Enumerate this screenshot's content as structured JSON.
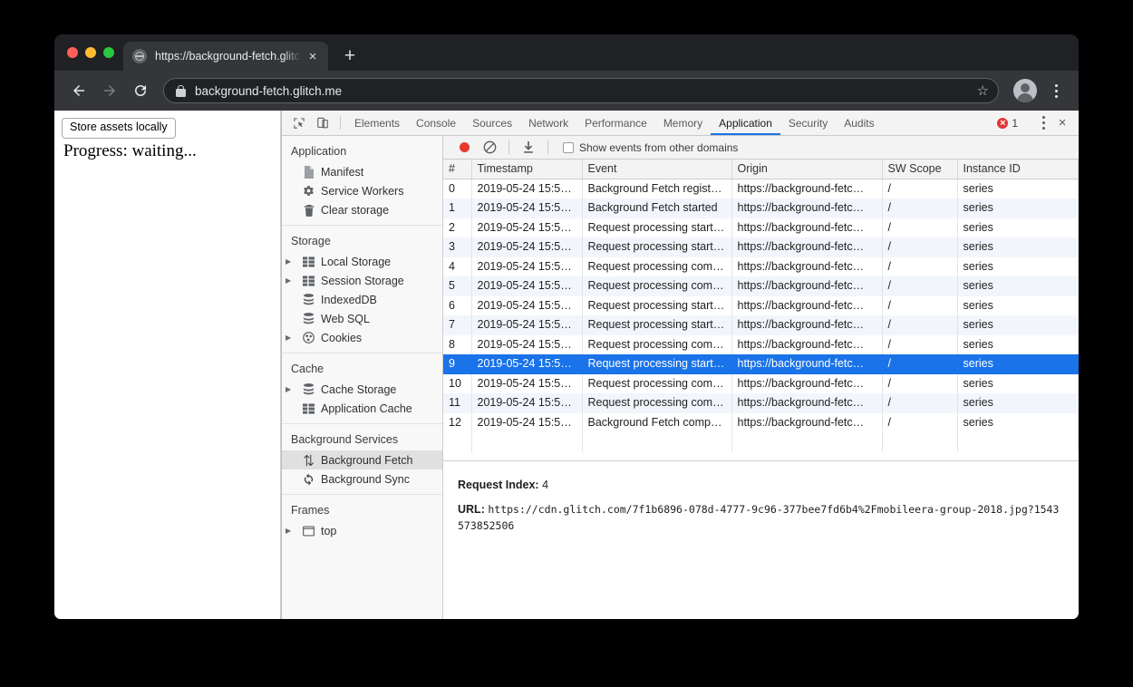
{
  "browser": {
    "tab": {
      "title": "https://background-fetch.glitch",
      "favicon": "globe-icon",
      "close": "×"
    },
    "new_tab": "+",
    "nav": {
      "back": "←",
      "forward": "→",
      "reload": "↻"
    },
    "omnibox": {
      "url": "background-fetch.glitch.me",
      "lock": "lock-icon",
      "star": "☆"
    },
    "menu": "kebab-menu-icon"
  },
  "page": {
    "store_button": "Store assets locally",
    "progress": "Progress: waiting..."
  },
  "devtools": {
    "tabs": [
      {
        "label": "Elements",
        "active": false
      },
      {
        "label": "Console",
        "active": false
      },
      {
        "label": "Sources",
        "active": false
      },
      {
        "label": "Network",
        "active": false
      },
      {
        "label": "Performance",
        "active": false
      },
      {
        "label": "Memory",
        "active": false
      },
      {
        "label": "Application",
        "active": true
      },
      {
        "label": "Security",
        "active": false
      },
      {
        "label": "Audits",
        "active": false
      }
    ],
    "error_count": "1",
    "close": "×",
    "sidebar": {
      "groups": [
        {
          "header": "Application",
          "items": [
            {
              "label": "Manifest",
              "icon": "document-icon",
              "arrow": false,
              "selected": false
            },
            {
              "label": "Service Workers",
              "icon": "gear-icon",
              "arrow": false,
              "selected": false
            },
            {
              "label": "Clear storage",
              "icon": "trash-icon",
              "arrow": false,
              "selected": false
            }
          ]
        },
        {
          "header": "Storage",
          "items": [
            {
              "label": "Local Storage",
              "icon": "table-icon",
              "arrow": true,
              "selected": false
            },
            {
              "label": "Session Storage",
              "icon": "table-icon",
              "arrow": true,
              "selected": false
            },
            {
              "label": "IndexedDB",
              "icon": "database-icon",
              "arrow": false,
              "selected": false
            },
            {
              "label": "Web SQL",
              "icon": "database-icon",
              "arrow": false,
              "selected": false
            },
            {
              "label": "Cookies",
              "icon": "cookie-icon",
              "arrow": true,
              "selected": false
            }
          ]
        },
        {
          "header": "Cache",
          "items": [
            {
              "label": "Cache Storage",
              "icon": "database-icon",
              "arrow": true,
              "selected": false
            },
            {
              "label": "Application Cache",
              "icon": "table-icon",
              "arrow": false,
              "selected": false
            }
          ]
        },
        {
          "header": "Background Services",
          "items": [
            {
              "label": "Background Fetch",
              "icon": "up-down-arrows-icon",
              "arrow": false,
              "selected": true
            },
            {
              "label": "Background Sync",
              "icon": "refresh-icon",
              "arrow": false,
              "selected": false
            }
          ]
        },
        {
          "header": "Frames",
          "items": [
            {
              "label": "top",
              "icon": "frame-icon",
              "arrow": true,
              "selected": false
            }
          ]
        }
      ]
    },
    "toolbar": {
      "record": "record-icon",
      "clear": "clear-icon",
      "export": "download-icon",
      "checkbox_label": "Show events from other domains",
      "checkbox_checked": false
    },
    "table": {
      "columns": [
        "#",
        "Timestamp",
        "Event",
        "Origin",
        "SW Scope",
        "Instance ID"
      ],
      "rows": [
        {
          "idx": "0",
          "ts": "2019-05-24 15:5…",
          "event": "Background Fetch regist…",
          "origin": "https://background-fetc…",
          "sw": "/",
          "id": "series"
        },
        {
          "idx": "1",
          "ts": "2019-05-24 15:5…",
          "event": "Background Fetch started",
          "origin": "https://background-fetc…",
          "sw": "/",
          "id": "series"
        },
        {
          "idx": "2",
          "ts": "2019-05-24 15:5…",
          "event": "Request processing start…",
          "origin": "https://background-fetc…",
          "sw": "/",
          "id": "series"
        },
        {
          "idx": "3",
          "ts": "2019-05-24 15:5…",
          "event": "Request processing start…",
          "origin": "https://background-fetc…",
          "sw": "/",
          "id": "series"
        },
        {
          "idx": "4",
          "ts": "2019-05-24 15:5…",
          "event": "Request processing com…",
          "origin": "https://background-fetc…",
          "sw": "/",
          "id": "series"
        },
        {
          "idx": "5",
          "ts": "2019-05-24 15:5…",
          "event": "Request processing com…",
          "origin": "https://background-fetc…",
          "sw": "/",
          "id": "series"
        },
        {
          "idx": "6",
          "ts": "2019-05-24 15:5…",
          "event": "Request processing start…",
          "origin": "https://background-fetc…",
          "sw": "/",
          "id": "series"
        },
        {
          "idx": "7",
          "ts": "2019-05-24 15:5…",
          "event": "Request processing start…",
          "origin": "https://background-fetc…",
          "sw": "/",
          "id": "series"
        },
        {
          "idx": "8",
          "ts": "2019-05-24 15:5…",
          "event": "Request processing com…",
          "origin": "https://background-fetc…",
          "sw": "/",
          "id": "series"
        },
        {
          "idx": "9",
          "ts": "2019-05-24 15:5…",
          "event": "Request processing start…",
          "origin": "https://background-fetc…",
          "sw": "/",
          "id": "series",
          "selected": true
        },
        {
          "idx": "10",
          "ts": "2019-05-24 15:5…",
          "event": "Request processing com…",
          "origin": "https://background-fetc…",
          "sw": "/",
          "id": "series"
        },
        {
          "idx": "11",
          "ts": "2019-05-24 15:5…",
          "event": "Request processing com…",
          "origin": "https://background-fetc…",
          "sw": "/",
          "id": "series"
        },
        {
          "idx": "12",
          "ts": "2019-05-24 15:5…",
          "event": "Background Fetch comp…",
          "origin": "https://background-fetc…",
          "sw": "/",
          "id": "series"
        }
      ]
    },
    "detail": {
      "request_index_key": "Request Index:",
      "request_index_value": "4",
      "url_key": "URL:",
      "url_value": "https://cdn.glitch.com/7f1b6896-078d-4777-9c96-377bee7fd6b4%2Fmobileera-group-2018.jpg?1543573852506"
    }
  },
  "colors": {
    "accent": "#1a73e8",
    "record": "#e8392e",
    "error": "#e03535",
    "chrome_dark": "#35363a",
    "tabstrip": "#202124"
  }
}
